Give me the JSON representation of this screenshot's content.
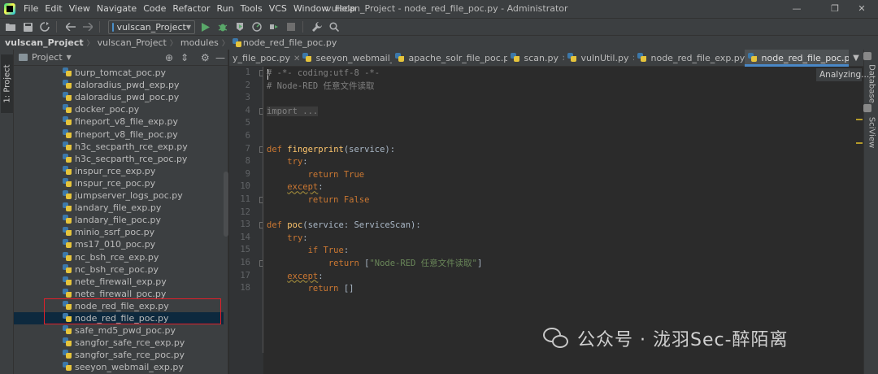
{
  "menu": [
    "File",
    "Edit",
    "View",
    "Navigate",
    "Code",
    "Refactor",
    "Run",
    "Tools",
    "VCS",
    "Window",
    "Help"
  ],
  "window_title": "vulscan_Project - node_red_file_poc.py - Administrator",
  "window_controls": {
    "minimize": "—",
    "restore": "❐",
    "close": "✕"
  },
  "toolbar": {
    "run_config": "vulscan_Project"
  },
  "breadcrumb": [
    "vulscan_Project",
    "vulscan_Project",
    "modules",
    "node_red_file_poc.py"
  ],
  "left_tool_tab": "1: Project",
  "project_panel": {
    "title": "Project"
  },
  "project_files": [
    "burp_tomcat_poc.py",
    "daloradius_pwd_exp.py",
    "daloradius_pwd_poc.py",
    "docker_poc.py",
    "fineport_v8_file_exp.py",
    "fineport_v8_file_poc.py",
    "h3c_secparth_rce_exp.py",
    "h3c_secparth_rce_poc.py",
    "inspur_rce_exp.py",
    "inspur_rce_poc.py",
    "jumpserver_logs_poc.py",
    "landary_file_exp.py",
    "landary_file_poc.py",
    "minio_ssrf_poc.py",
    "ms17_010_poc.py",
    "nc_bsh_rce_exp.py",
    "nc_bsh_rce_poc.py",
    "nete_firewall_exp.py",
    "nete_firewall_poc.py",
    "node_red_file_exp.py",
    "node_red_file_poc.py",
    "safe_md5_pwd_poc.py",
    "sangfor_safe_rce_exp.py",
    "sangfor_safe_rce_poc.py",
    "seeyon_webmail_exp.py"
  ],
  "selected_file": "node_red_file_poc.py",
  "tabs": [
    "y_file_poc.py",
    "seeyon_webmail_poc.py",
    "apache_solr_file_poc.py",
    "scan.py",
    "vulnUtil.py",
    "node_red_file_exp.py",
    "node_red_file_poc.py"
  ],
  "active_tab": "node_red_file_poc.py",
  "right_tool_tabs": [
    "Database",
    "SciView"
  ],
  "status": {
    "analyzing": "Analyzing..."
  },
  "code_lines": [
    {
      "n": "1",
      "segments": [
        {
          "t": "# -*- coding:utf-8 -*-",
          "c": "comment"
        }
      ]
    },
    {
      "n": "2",
      "segments": [
        {
          "t": "# Node-RED 任意文件读取",
          "c": "comment"
        }
      ]
    },
    {
      "n": "3",
      "segments": []
    },
    {
      "n": "4",
      "segments": [
        {
          "t": "import ...",
          "c": "fold"
        }
      ]
    },
    {
      "n": "5",
      "segments": []
    },
    {
      "n": "6",
      "segments": []
    },
    {
      "n": "7",
      "segments": [
        {
          "t": "def ",
          "c": "kw"
        },
        {
          "t": "fingerprint",
          "c": "fn"
        },
        {
          "t": "(service):",
          "c": "plain"
        }
      ]
    },
    {
      "n": "8",
      "segments": [
        {
          "t": "    ",
          "c": "plain"
        },
        {
          "t": "try",
          "c": "kw"
        },
        {
          "t": ":",
          "c": "plain"
        }
      ]
    },
    {
      "n": "9",
      "segments": [
        {
          "t": "        ",
          "c": "plain"
        },
        {
          "t": "return True",
          "c": "kw"
        }
      ]
    },
    {
      "n": "10",
      "segments": [
        {
          "t": "    ",
          "c": "plain"
        },
        {
          "t": "except",
          "c": "kw warn"
        },
        {
          "t": ":",
          "c": "plain"
        }
      ]
    },
    {
      "n": "11",
      "segments": [
        {
          "t": "        ",
          "c": "plain"
        },
        {
          "t": "return False",
          "c": "kw"
        }
      ]
    },
    {
      "n": "12",
      "segments": []
    },
    {
      "n": "13",
      "segments": [
        {
          "t": "def ",
          "c": "kw"
        },
        {
          "t": "poc",
          "c": "fn"
        },
        {
          "t": "(service: ServiceScan):",
          "c": "plain"
        }
      ]
    },
    {
      "n": "14",
      "segments": [
        {
          "t": "    ",
          "c": "plain"
        },
        {
          "t": "try",
          "c": "kw"
        },
        {
          "t": ":",
          "c": "plain"
        }
      ]
    },
    {
      "n": "15",
      "segments": [
        {
          "t": "        ",
          "c": "plain"
        },
        {
          "t": "if True",
          "c": "kw"
        },
        {
          "t": ":",
          "c": "plain"
        }
      ]
    },
    {
      "n": "16",
      "segments": [
        {
          "t": "            ",
          "c": "plain"
        },
        {
          "t": "return ",
          "c": "kw"
        },
        {
          "t": "[",
          "c": "plain"
        },
        {
          "t": "\"Node-RED 任意文件读取\"",
          "c": "str"
        },
        {
          "t": "]",
          "c": "plain"
        }
      ]
    },
    {
      "n": "17",
      "segments": [
        {
          "t": "    ",
          "c": "plain"
        },
        {
          "t": "except",
          "c": "kw warn"
        },
        {
          "t": ":",
          "c": "plain"
        }
      ]
    },
    {
      "n": "18",
      "segments": [
        {
          "t": "        ",
          "c": "plain"
        },
        {
          "t": "return ",
          "c": "kw"
        },
        {
          "t": "[]",
          "c": "plain"
        }
      ]
    }
  ],
  "watermark": "公众号 · 泷羽Sec-醉陌离"
}
